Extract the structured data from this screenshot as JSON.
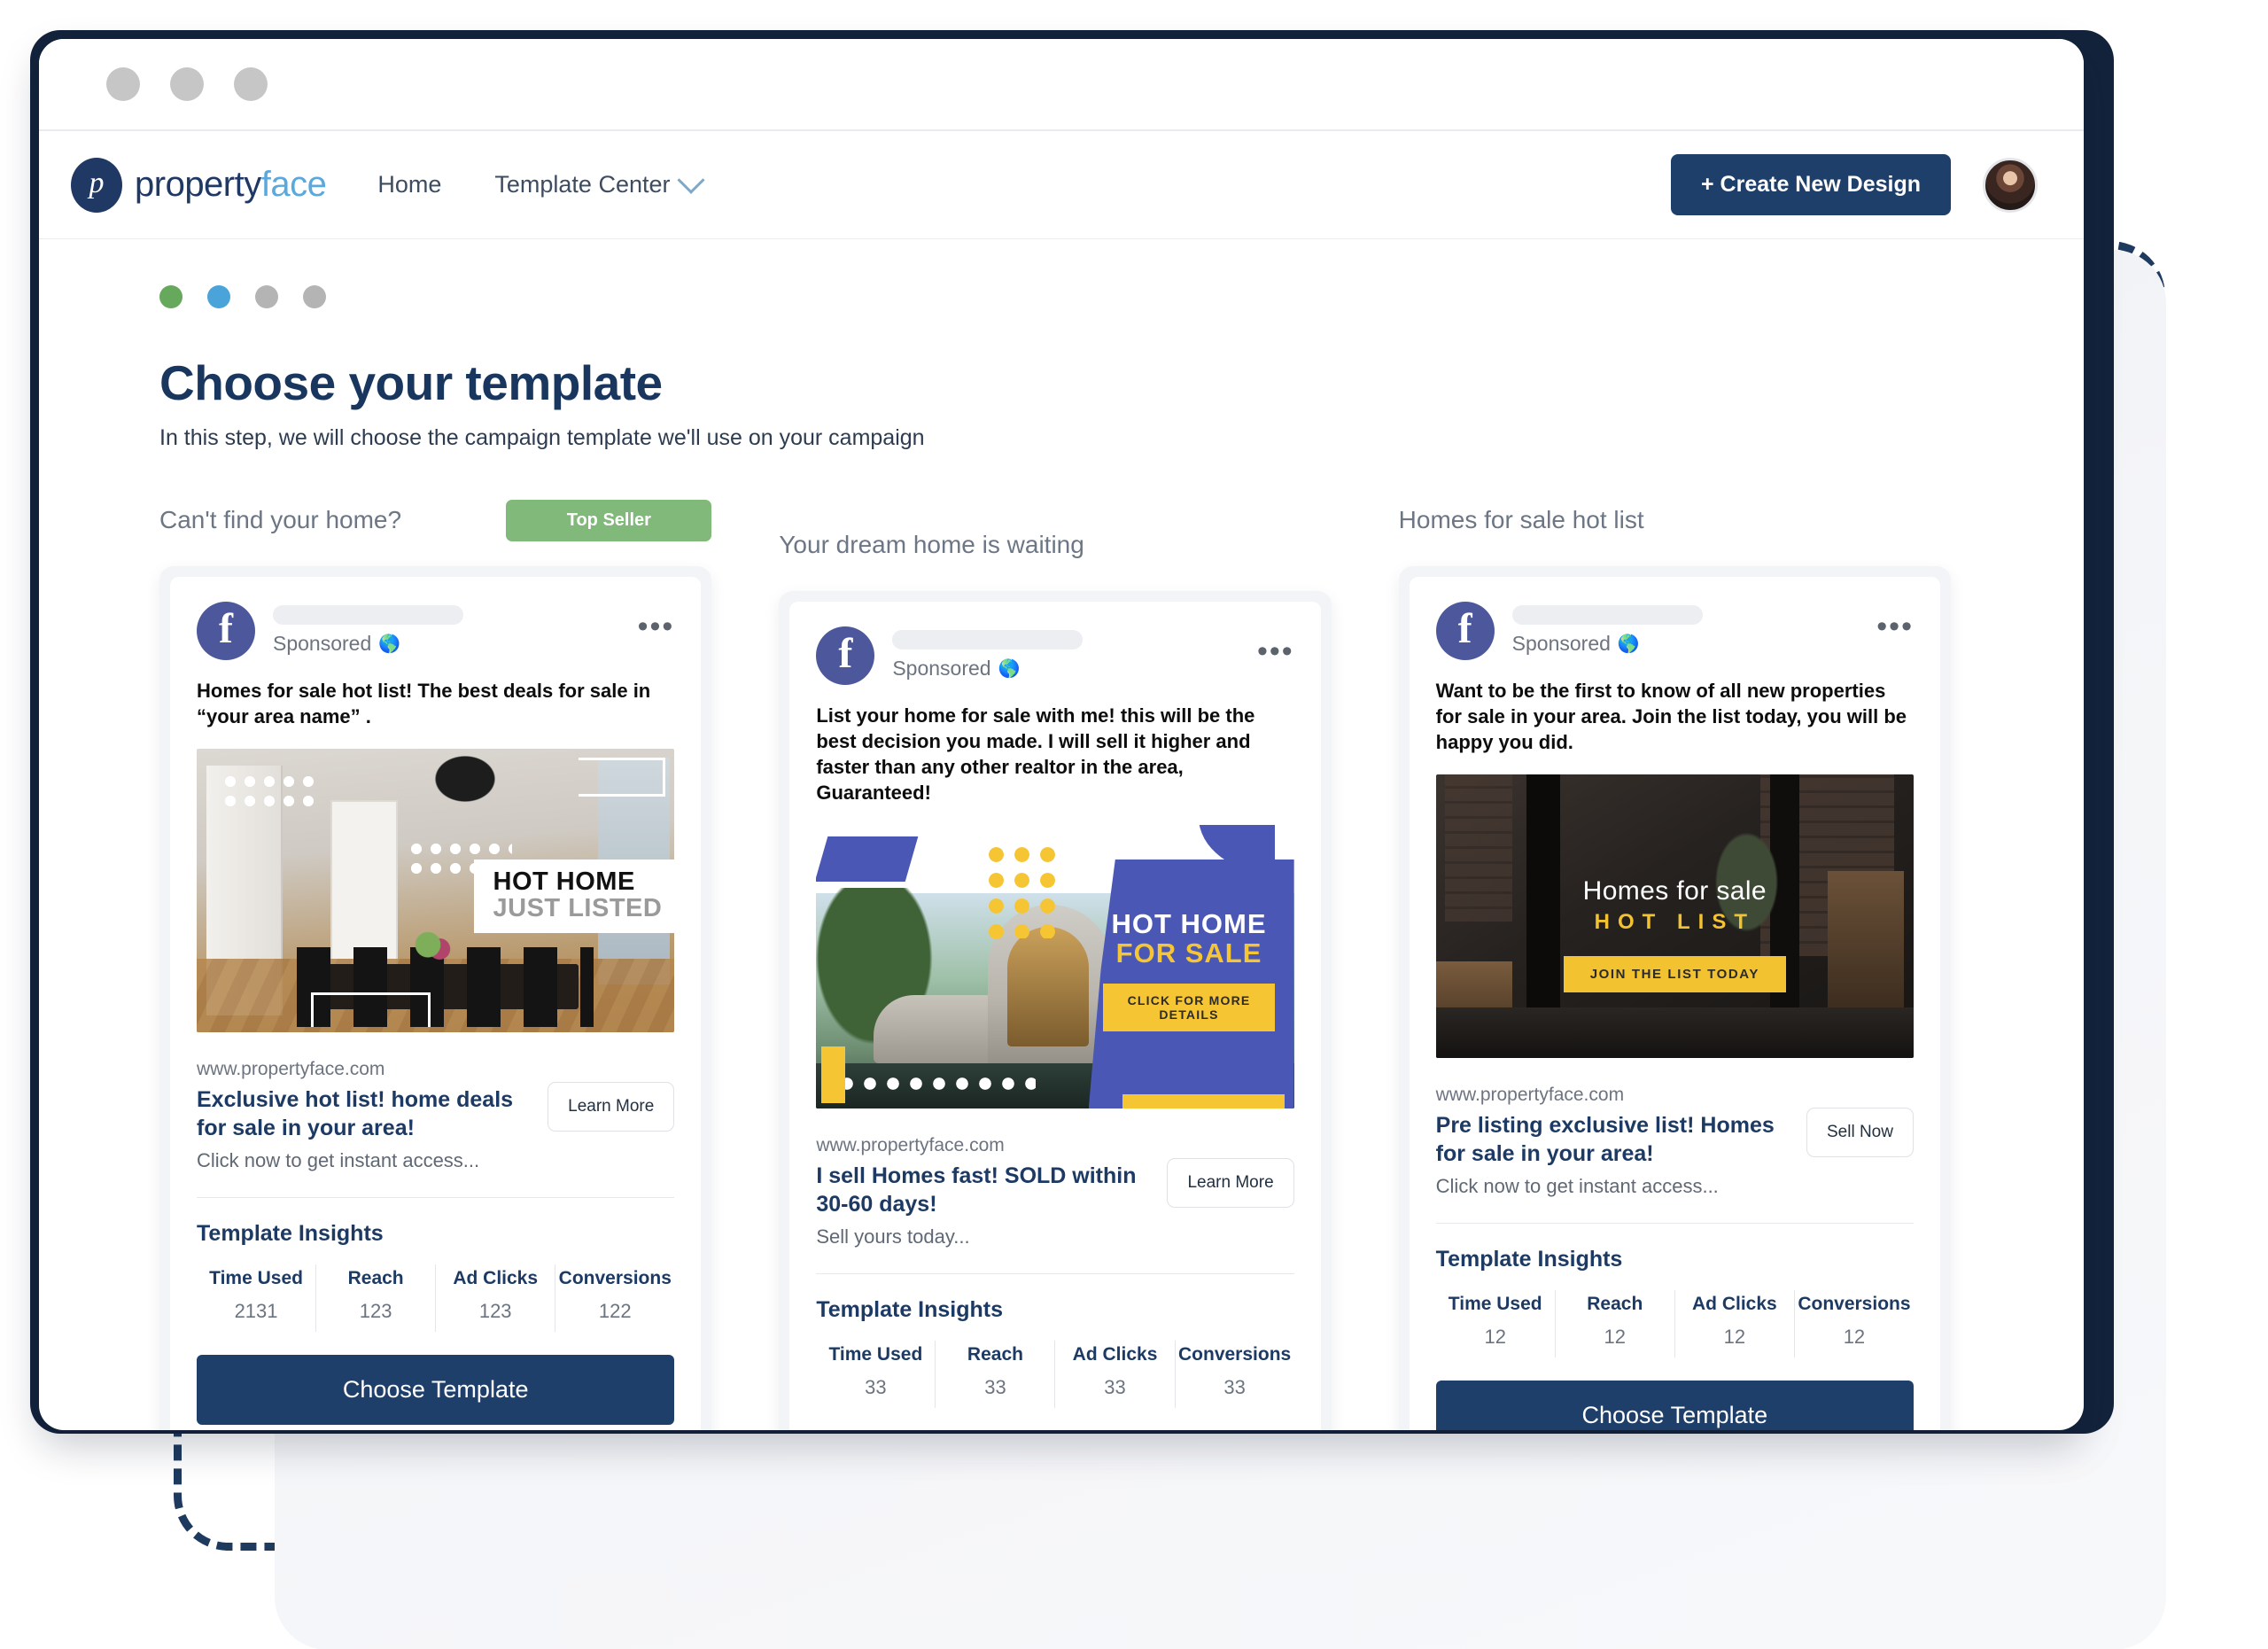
{
  "window": {
    "dots": [
      "minimize",
      "maximize",
      "close"
    ]
  },
  "nav": {
    "brand_part1": "property",
    "brand_part2": "face",
    "brand_mark_letter": "p",
    "links": [
      {
        "label": "Home",
        "has_chevron": false
      },
      {
        "label": "Template Center",
        "has_chevron": true
      }
    ],
    "create_button": "+ Create New Design"
  },
  "steps": {
    "colors": [
      "#66a85c",
      "#4aa3d9",
      "#b4b4b4",
      "#b4b4b4"
    ]
  },
  "page": {
    "title": "Choose your template",
    "subtitle": "In this step, we will choose the campaign template we'll use on your campaign"
  },
  "labels": {
    "sponsored": "Sponsored",
    "globe_icon": "globe-icon",
    "more_icon": "more-options-icon",
    "insights_title": "Template Insights",
    "choose_button": "Choose Template",
    "stat_keys": [
      "Time Used",
      "Reach",
      "Ad Clicks",
      "Conversions"
    ]
  },
  "colors": {
    "primary": "#1f3f6b",
    "accent_blue": "#4aa3d9",
    "accent_green": "#66a85c",
    "badge_green": "#80b97a",
    "facebook_blue": "#4c589b",
    "heading_navy": "#19375e",
    "yellow": "#f3c231"
  },
  "cards": [
    {
      "column_title": "Can't find your home?",
      "badge": "Top Seller",
      "ad_copy": "Homes for sale hot list! The best deals for sale in “your area name” .",
      "creative": {
        "name": "dining-room-hot-home-just-listed",
        "line1": "HOT HOME",
        "line2": "JUST LISTED"
      },
      "url": "www.propertyface.com",
      "headline": "Exclusive hot list! home deals for sale in your area!",
      "subline": "Click now to get instant access...",
      "cta": "Learn More",
      "stats": {
        "time_used": "2131",
        "reach": "123",
        "ad_clicks": "123",
        "conversions": "122"
      }
    },
    {
      "column_title": "Your dream home is waiting",
      "badge": null,
      "ad_copy": "List your home for sale with me! this will be the best decision you made. I will sell it higher and faster than any other realtor in the area, Guaranteed!",
      "creative": {
        "name": "modern-house-hot-home-for-sale",
        "line1": "HOT HOME",
        "line2": "FOR SALE",
        "cta_overlay": "CLICK FOR MORE DETAILS"
      },
      "url": "www.propertyface.com",
      "headline": "I sell Homes fast! SOLD within 30-60 days!",
      "subline": "Sell yours today...",
      "cta": "Learn More",
      "stats": {
        "time_used": "33",
        "reach": "33",
        "ad_clicks": "33",
        "conversions": "33"
      }
    },
    {
      "column_title": "Homes for sale hot list",
      "badge": null,
      "ad_copy": "Want to be the first to know of all new properties for sale in your area. Join the list today, you will be happy you did.",
      "creative": {
        "name": "dark-loft-homes-for-sale-hot-list",
        "line1": "Homes for sale",
        "line2": "HOT LIST",
        "cta_overlay": "JOIN THE LIST TODAY"
      },
      "url": "www.propertyface.com",
      "headline": "Pre listing exclusive list! Homes for sale in your area!",
      "subline": "Click now to get instant access...",
      "cta": "Sell Now",
      "stats": {
        "time_used": "12",
        "reach": "12",
        "ad_clicks": "12",
        "conversions": "12"
      }
    }
  ]
}
